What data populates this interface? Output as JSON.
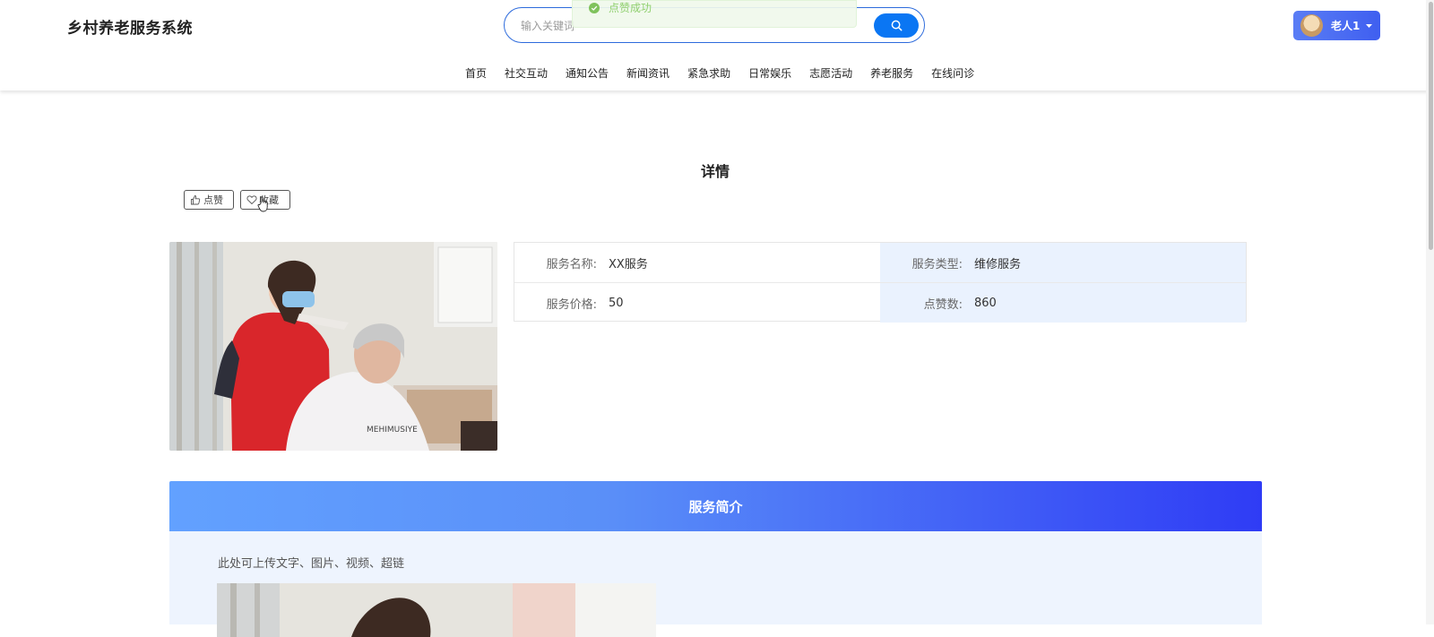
{
  "header": {
    "site_title": "乡村养老服务系统",
    "search": {
      "placeholder": "输入关键词",
      "value": ""
    },
    "user": {
      "name": "老人1"
    }
  },
  "toast": {
    "message": "点赞成功",
    "type": "success"
  },
  "nav": {
    "items": [
      {
        "label": "首页"
      },
      {
        "label": "社交互动"
      },
      {
        "label": "通知公告"
      },
      {
        "label": "新闻资讯"
      },
      {
        "label": "紧急求助"
      },
      {
        "label": "日常娱乐"
      },
      {
        "label": "志愿活动"
      },
      {
        "label": "养老服务"
      },
      {
        "label": "在线问诊"
      }
    ]
  },
  "page": {
    "title": "详情"
  },
  "actions": {
    "like_label": "点赞",
    "favorite_label": "收藏"
  },
  "details": {
    "service_name": {
      "label": "服务名称:",
      "value": "XX服务"
    },
    "service_type": {
      "label": "服务类型:",
      "value": "维修服务"
    },
    "service_price": {
      "label": "服务价格:",
      "value": "50"
    },
    "like_count": {
      "label": "点赞数:",
      "value": "860"
    }
  },
  "intro": {
    "header": "服务简介",
    "text": "此处可上传文字、图片、视频、超链"
  },
  "colors": {
    "accent": "#0a76f3",
    "section_gradient_start": "#62a1ff",
    "section_gradient_end": "#2f3cf5",
    "toast_text": "#8fcf6e"
  }
}
